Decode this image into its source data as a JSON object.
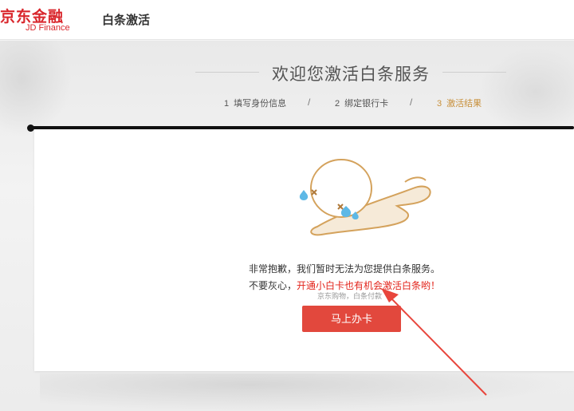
{
  "header": {
    "logo_cn": "京东金融",
    "logo_en": "JD Finance",
    "title": "白条激活"
  },
  "welcome": {
    "title": "欢迎您激活白条服务"
  },
  "steps": [
    {
      "num": "1",
      "label": "填写身份信息"
    },
    {
      "num": "2",
      "label": "绑定银行卡"
    },
    {
      "num": "3",
      "label": "激活结果"
    }
  ],
  "step_separator": "/",
  "result": {
    "line1": "非常抱歉，我们暂时无法为您提供白条服务。",
    "line2_prefix": "不要灰心，",
    "line2_highlight": "开通小白卡也有机会激活白条哟！",
    "note": "京东购物，白条付款",
    "cta_label": "马上办卡"
  },
  "colors": {
    "brand_red": "#d9262c",
    "cta": "#e2483d",
    "highlight_red": "#e2231a",
    "active_step": "#c8903b",
    "annotation_arrow": "#e8453c"
  }
}
